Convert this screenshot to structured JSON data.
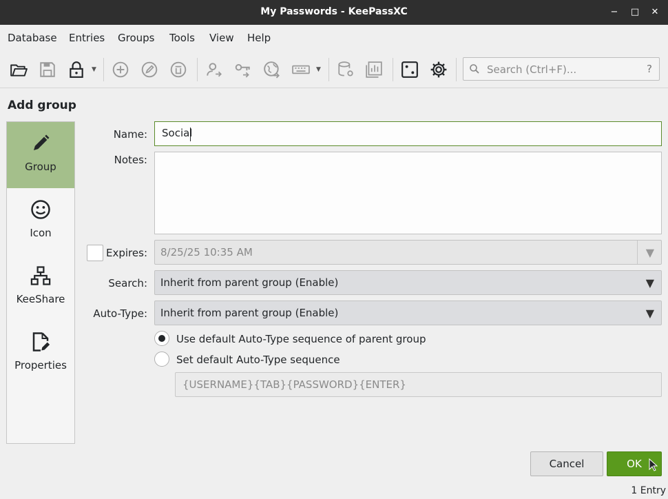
{
  "window": {
    "title": "My Passwords - KeePassXC",
    "minimize": "−",
    "maximize": "□",
    "close": "✕"
  },
  "menu": [
    "Database",
    "Entries",
    "Groups",
    "Tools",
    "View",
    "Help"
  ],
  "toolbar": {
    "icons": [
      "open-database-icon",
      "save-database-icon",
      "lock-database-icon",
      "add-entry-icon",
      "edit-entry-icon",
      "delete-entry-icon",
      "copy-username-icon",
      "copy-password-icon",
      "copy-url-icon",
      "auto-type-icon",
      "database-settings-icon",
      "database-reports-icon",
      "password-generator-icon",
      "settings-icon"
    ],
    "search_placeholder": "Search (Ctrl+F)...",
    "search_help": "?"
  },
  "heading": "Add group",
  "sidebar": {
    "items": [
      {
        "label": "Group",
        "icon": "pencil-icon"
      },
      {
        "label": "Icon",
        "icon": "smiley-icon"
      },
      {
        "label": "KeeShare",
        "icon": "network-icon"
      },
      {
        "label": "Properties",
        "icon": "document-edit-icon"
      }
    ]
  },
  "form": {
    "name_label": "Name:",
    "name_value": "Social",
    "notes_label": "Notes:",
    "notes_value": "",
    "expires_label": "Expires:",
    "expires_value": "8/25/25 10:35 AM",
    "search_label": "Search:",
    "search_value": "Inherit from parent group (Enable)",
    "autotype_label": "Auto-Type:",
    "autotype_value": "Inherit from parent group (Enable)",
    "radio_default": "Use default Auto-Type sequence of parent group",
    "radio_custom": "Set default Auto-Type sequence",
    "sequence_value": "{USERNAME}{TAB}{PASSWORD}{ENTER}"
  },
  "buttons": {
    "cancel": "Cancel",
    "ok": "OK"
  },
  "status": "1 Entry",
  "colors": {
    "accent": "#5a9a1d",
    "sidebar_active": "#a4bf8b",
    "titlebar": "#2f2f2f"
  }
}
